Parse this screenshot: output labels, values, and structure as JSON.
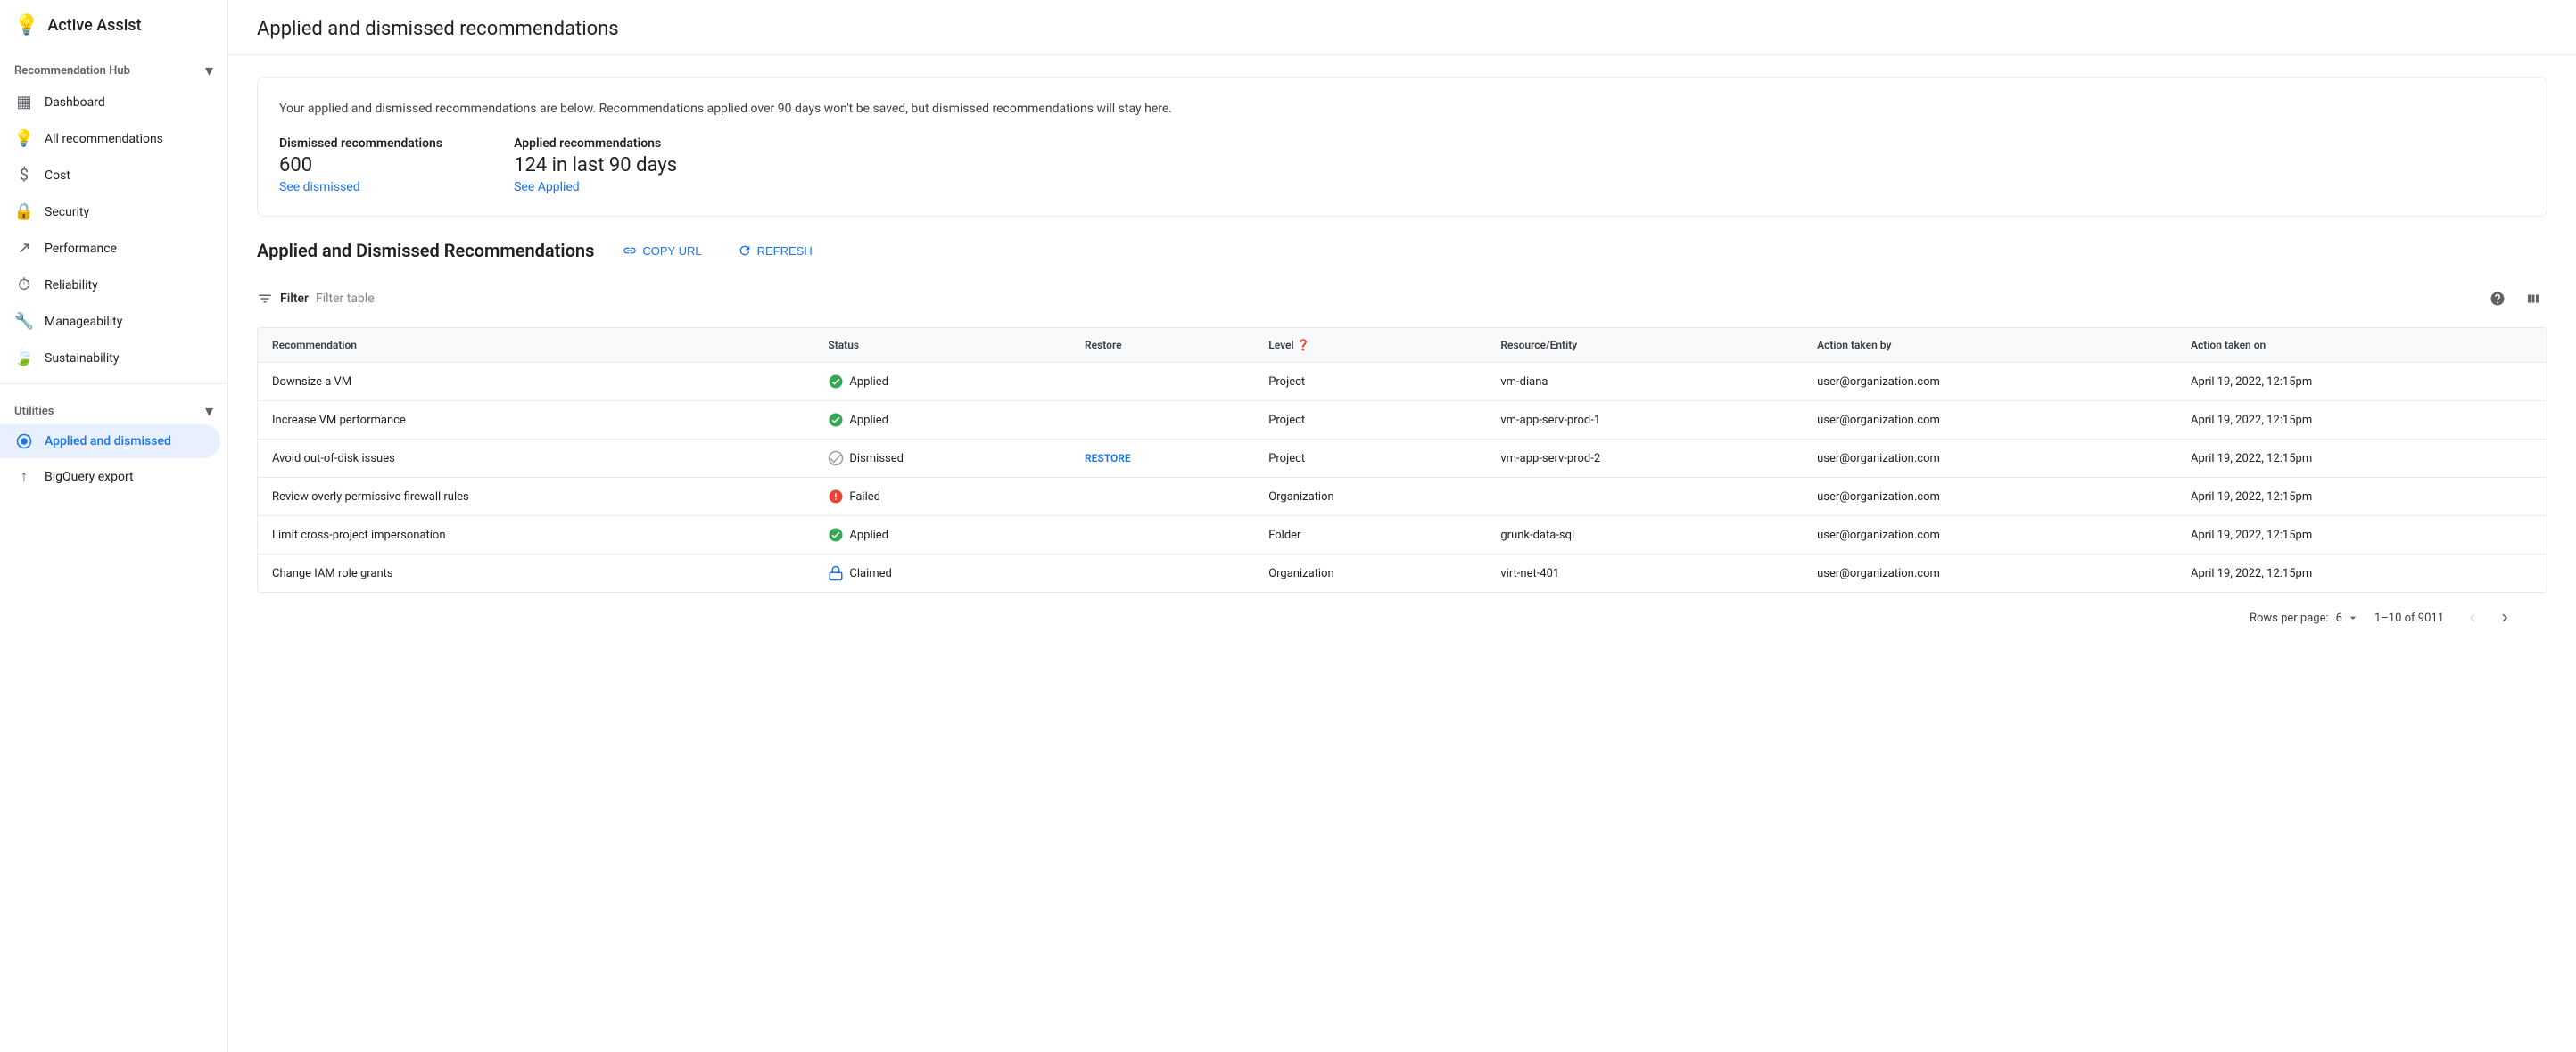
{
  "sidebar": {
    "app_name": "Active Assist",
    "app_icon": "💡",
    "sections": [
      {
        "label": "Recommendation Hub",
        "collapsible": true,
        "items": [
          {
            "id": "dashboard",
            "label": "Dashboard",
            "icon": "▦"
          },
          {
            "id": "all-recommendations",
            "label": "All recommendations",
            "icon": "💡"
          },
          {
            "id": "cost",
            "label": "Cost",
            "icon": "$"
          },
          {
            "id": "security",
            "label": "Security",
            "icon": "🔒"
          },
          {
            "id": "performance",
            "label": "Performance",
            "icon": "↗"
          },
          {
            "id": "reliability",
            "label": "Reliability",
            "icon": "⏱"
          },
          {
            "id": "manageability",
            "label": "Manageability",
            "icon": "🔧"
          },
          {
            "id": "sustainability",
            "label": "Sustainability",
            "icon": "🍃"
          }
        ]
      },
      {
        "label": "Utilities",
        "collapsible": true,
        "items": [
          {
            "id": "applied-and-dismissed",
            "label": "Applied and dismissed",
            "icon": "⏱",
            "active": true
          },
          {
            "id": "bigquery-export",
            "label": "BigQuery export",
            "icon": "↑"
          }
        ]
      }
    ]
  },
  "main": {
    "page_title": "Applied and dismissed recommendations",
    "info_card": {
      "description": "Your applied and dismissed recommendations are below. Recommendations applied over 90 days won't be saved, but dismissed recommendations will stay here.",
      "dismissed": {
        "label": "Dismissed recommendations",
        "value": "600",
        "link_text": "See dismissed"
      },
      "applied": {
        "label": "Applied recommendations",
        "value": "124 in last 90 days",
        "link_text": "See Applied"
      }
    },
    "table_section": {
      "title": "Applied and Dismissed Recommendations",
      "copy_url_label": "COPY URL",
      "refresh_label": "REFRESH",
      "filter_label": "Filter",
      "filter_placeholder": "Filter table",
      "columns": [
        {
          "id": "recommendation",
          "label": "Recommendation"
        },
        {
          "id": "status",
          "label": "Status"
        },
        {
          "id": "restore",
          "label": "Restore"
        },
        {
          "id": "level",
          "label": "Level"
        },
        {
          "id": "resource",
          "label": "Resource/Entity"
        },
        {
          "id": "action_by",
          "label": "Action taken by"
        },
        {
          "id": "action_on",
          "label": "Action taken on"
        }
      ],
      "rows": [
        {
          "recommendation": "Downsize a VM",
          "status": "Applied",
          "status_type": "applied",
          "restore": "",
          "level": "Project",
          "resource": "vm-diana",
          "action_by": "user@organization.com",
          "action_on": "April 19, 2022, 12:15pm"
        },
        {
          "recommendation": "Increase VM performance",
          "status": "Applied",
          "status_type": "applied",
          "restore": "",
          "level": "Project",
          "resource": "vm-app-serv-prod-1",
          "action_by": "user@organization.com",
          "action_on": "April 19, 2022, 12:15pm"
        },
        {
          "recommendation": "Avoid out-of-disk issues",
          "status": "Dismissed",
          "status_type": "dismissed",
          "restore": "RESTORE",
          "level": "Project",
          "resource": "vm-app-serv-prod-2",
          "action_by": "user@organization.com",
          "action_on": "April 19, 2022, 12:15pm"
        },
        {
          "recommendation": "Review overly permissive firewall rules",
          "status": "Failed",
          "status_type": "failed",
          "restore": "",
          "level": "Organization",
          "resource": "",
          "action_by": "user@organization.com",
          "action_on": "April 19, 2022, 12:15pm"
        },
        {
          "recommendation": "Limit cross-project impersonation",
          "status": "Applied",
          "status_type": "applied",
          "restore": "",
          "level": "Folder",
          "resource": "grunk-data-sql",
          "action_by": "user@organization.com",
          "action_on": "April 19, 2022, 12:15pm"
        },
        {
          "recommendation": "Change IAM role grants",
          "status": "Claimed",
          "status_type": "claimed",
          "restore": "",
          "level": "Organization",
          "resource": "virt-net-401",
          "action_by": "user@organization.com",
          "action_on": "April 19, 2022, 12:15pm"
        }
      ],
      "pagination": {
        "rows_per_page_label": "Rows per page:",
        "rows_per_page_value": "6",
        "page_range": "1–10 of 9011"
      }
    }
  }
}
